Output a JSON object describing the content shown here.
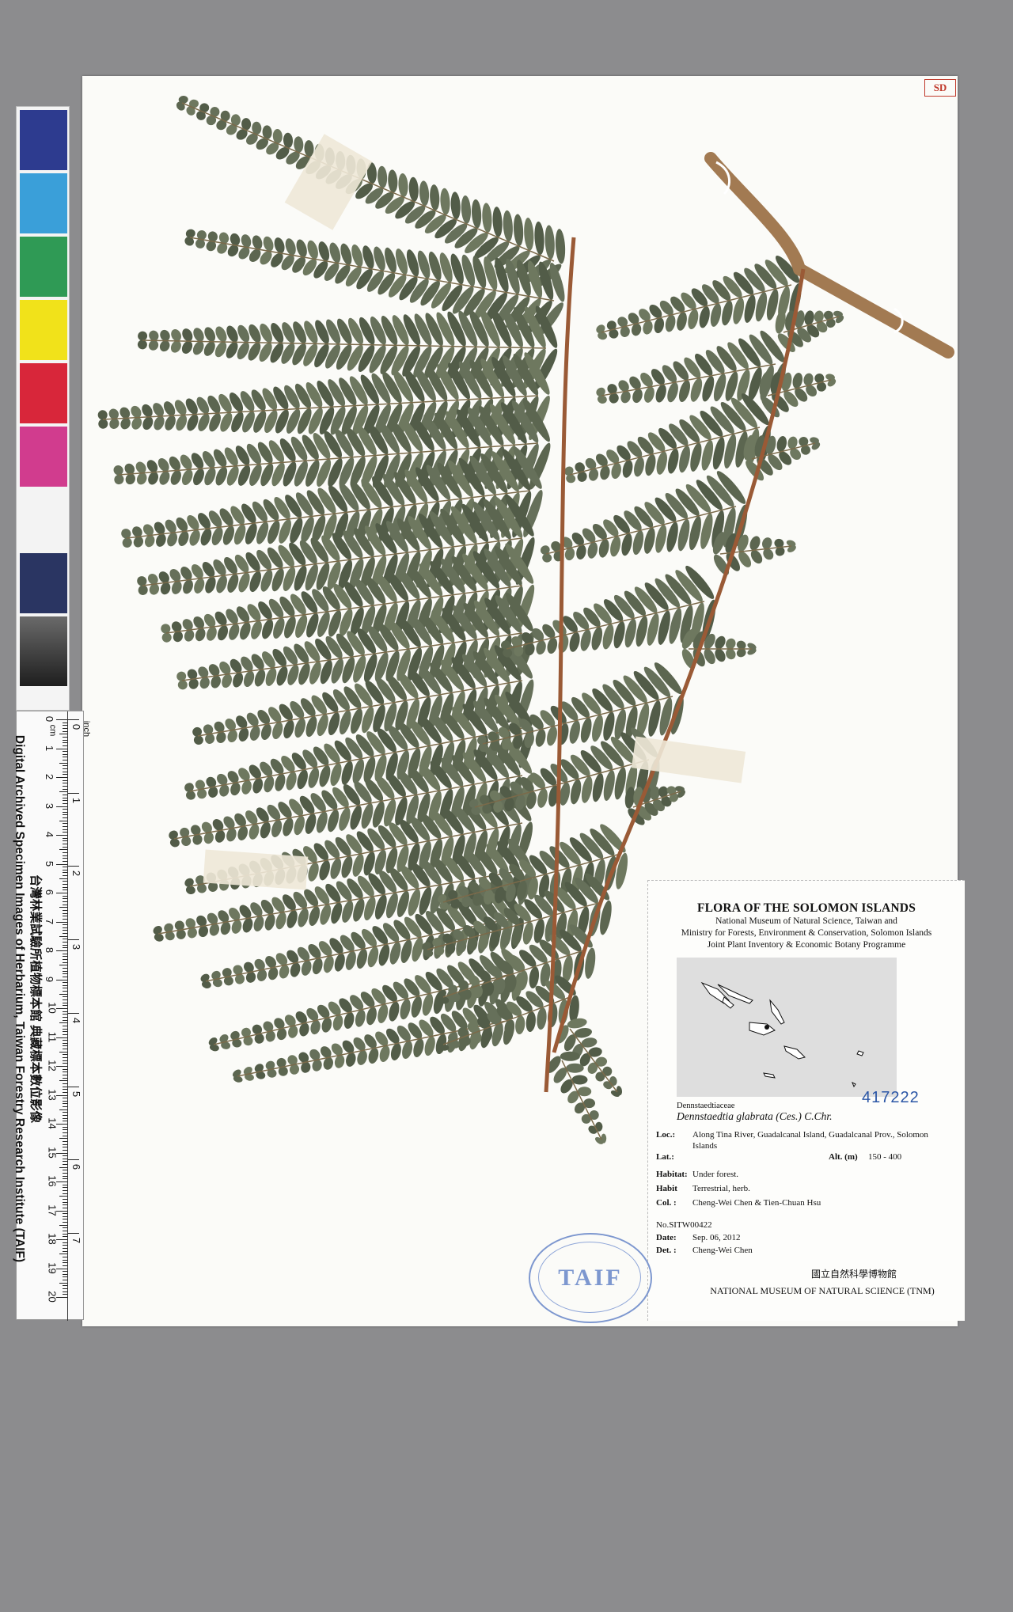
{
  "sheet": {
    "stamp": "SD"
  },
  "color_bar": {
    "patches": [
      "#2d3b8f",
      "#3a9fd9",
      "#2f9a55",
      "#f1e21a",
      "#d8263a",
      "#d13c8e",
      "#f3f3f3",
      "#2a3562"
    ]
  },
  "ruler": {
    "cm_unit": "cm",
    "inch_unit": "inch",
    "cm_ticks": [
      "0",
      "1",
      "2",
      "3",
      "4",
      "5",
      "6",
      "7",
      "8",
      "9",
      "10",
      "11",
      "12",
      "13",
      "14",
      "15",
      "16",
      "17",
      "18",
      "19",
      "20"
    ],
    "inch_ticks": [
      "0",
      "1",
      "2",
      "3",
      "4",
      "5",
      "6",
      "7"
    ]
  },
  "institute": {
    "zh": "台灣林業試驗所植物標本館 典藏標本數位影像",
    "en": "Digital Archived Specimen Images of Herbarium, Taiwan Forestry Research Institute (TAIF)"
  },
  "label": {
    "title": "FLORA OF THE SOLOMON ISLANDS",
    "sub1": "National Museum of Natural Science, Taiwan and",
    "sub2": "Ministry for Forests, Environment & Conservation, Solomon Islands",
    "sub3": "Joint Plant Inventory & Economic Botany Programme",
    "family": "Dennstaedtiaceae",
    "species": "Dennstaedtia glabrata (Ces.) C.Chr.",
    "accession": "417222",
    "loc_key": "Loc.:",
    "loc_val": "Along Tina River, Guadalcanal Island, Guadalcanal Prov., Solomon Islands",
    "lat_key": "Lat.:",
    "alt_key": "Alt. (m)",
    "alt_val": "150 - 400",
    "habitat_key": "Habitat:",
    "habitat_val": "Under forest.",
    "habit_key": "Habit",
    "habit_val": "Terrestrial, herb.",
    "col_key": "Col. :",
    "col_val": "Cheng-Wei Chen & Tien-Chuan Hsu",
    "number": "No.SITW00422",
    "date_key": "Date:",
    "date_val": "Sep. 06, 2012",
    "det_key": "Det. :",
    "det_val": "Cheng-Wei Chen",
    "footer_zh": "國立自然科學博物館",
    "footer_en": "NATIONAL MUSEUM OF NATURAL SCIENCE (TNM)"
  },
  "seal": {
    "text": "TAIF"
  }
}
